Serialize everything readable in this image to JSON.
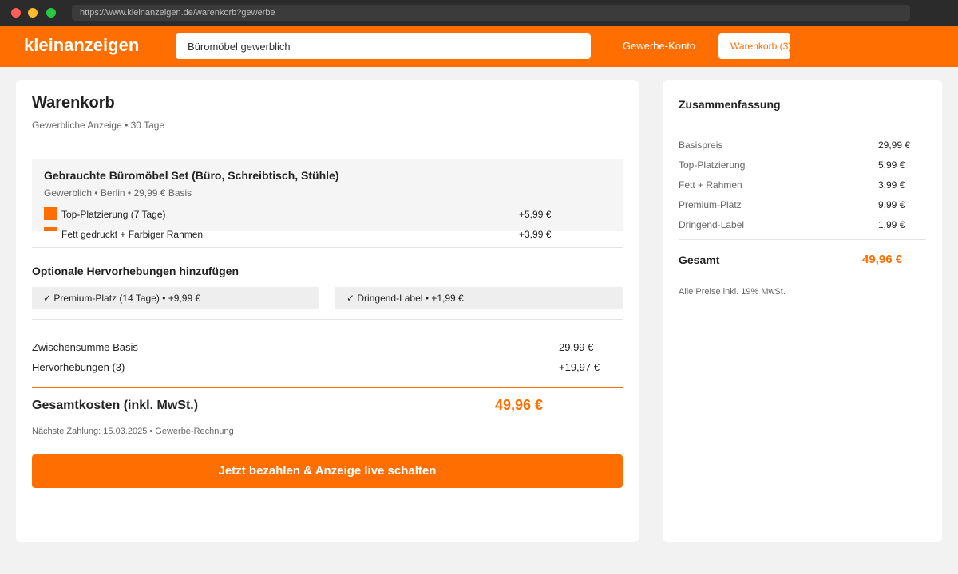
{
  "browser": {
    "url": "https://www.kleinanzeigen.de/warenkorb?gewerbe"
  },
  "header": {
    "logo": "kleinanzeigen",
    "search_value": "Büromöbel gewerblich",
    "nav_link": "Gewerbe-Konto",
    "cart_label": "Warenkorb (3)"
  },
  "cart": {
    "title": "Warenkorb",
    "subtitle": "Gewerbliche Anzeige • 30 Tage",
    "item": {
      "title": "Gebrauchte Büromöbel Set (Büro, Schreibtisch, Stühle)",
      "meta": "Gewerblich • Berlin • 29,99 € Basis",
      "addons": [
        {
          "label": "Top-Platzierung (7 Tage)",
          "price": "+5,99 €"
        },
        {
          "label": "Fett gedruckt + Farbiger Rahmen",
          "price": "+3,99 €"
        }
      ]
    },
    "optional_heading": "Optionale Hervorhebungen hinzufügen",
    "optional": [
      {
        "label": "✓ Premium-Platz (14 Tage) • +9,99 €"
      },
      {
        "label": "✓ Dringend-Label • +1,99 €"
      }
    ],
    "subtotal_label": "Zwischensumme Basis",
    "subtotal_value": "29,99 €",
    "extras_label": "Hervorhebungen (3)",
    "extras_value": "+19,97 €",
    "total_label": "Gesamtkosten (inkl. MwSt.)",
    "total_value": "49,96 €",
    "next_payment": "Nächste Zahlung: 15.03.2025 • Gewerbe-Rechnung",
    "pay_button": "Jetzt bezahlen & Anzeige live schalten"
  },
  "summary": {
    "title": "Zusammenfassung",
    "lines": [
      {
        "label": "Basispreis",
        "value": "29,99 €"
      },
      {
        "label": "Top-Platzierung",
        "value": "5,99 €"
      },
      {
        "label": "Fett + Rahmen",
        "value": "3,99 €"
      },
      {
        "label": "Premium-Platz",
        "value": "9,99 €"
      },
      {
        "label": "Dringend-Label",
        "value": "1,99 €"
      }
    ],
    "total_label": "Gesamt",
    "total_value": "49,96 €",
    "note": "Alle Preise inkl. 19% MwSt."
  },
  "colors": {
    "accent": "#ff6e00",
    "chrome": "#2b2b2b",
    "background": "#f2f2f2"
  }
}
